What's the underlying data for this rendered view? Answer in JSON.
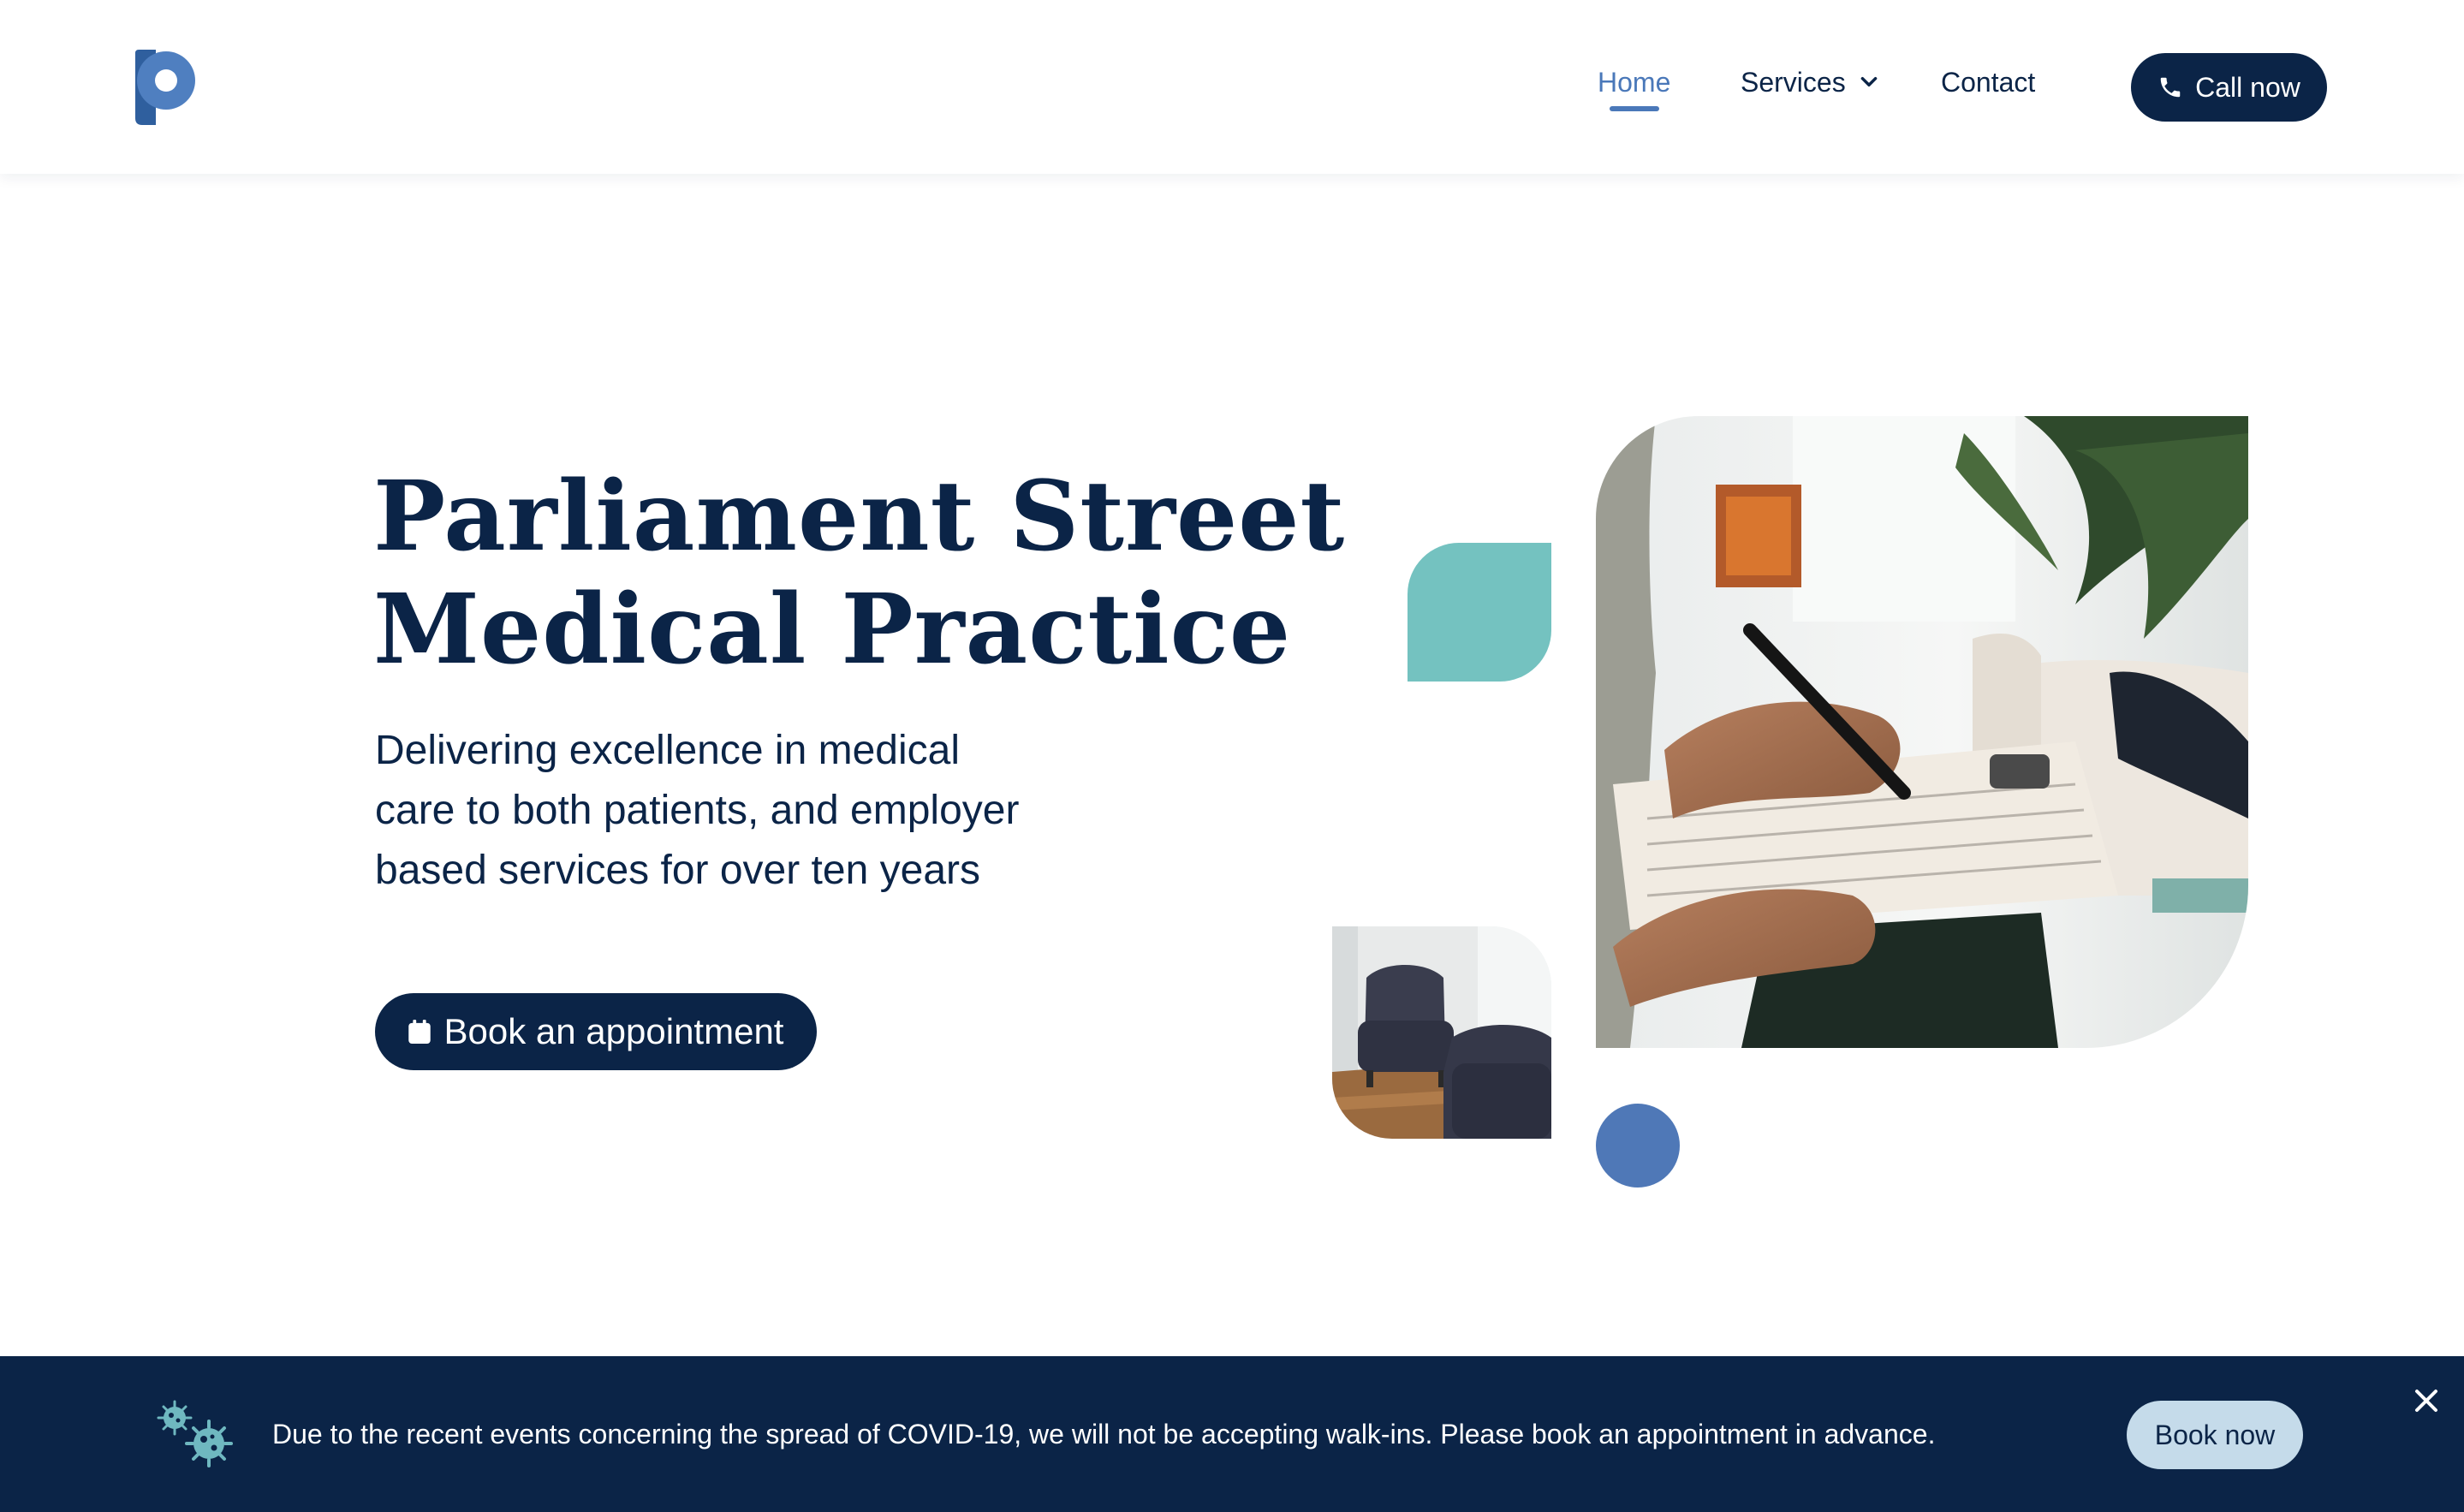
{
  "header": {
    "logo_icon": "p-logo-icon",
    "nav": {
      "home_label": "Home",
      "services_label": "Services",
      "services_icon": "chevron-down-icon",
      "contact_label": "Contact"
    },
    "call_button": {
      "label": "Call now",
      "icon": "phone-icon"
    }
  },
  "hero": {
    "title_line1": "Parliament Street",
    "title_line2": "Medical Practice",
    "subtitle_line1": "Delivering excellence in medical",
    "subtitle_line2": "care to both patients, and employer",
    "subtitle_line3": "based services for over ten years",
    "book_button": {
      "label": "Book an appointment",
      "icon": "calendar-icon"
    }
  },
  "banner": {
    "icon": "virus-icon",
    "message": "Due to the recent events concerning the spread of COVID-19, we will not be accepting walk-ins. Please book an appointment in advance.",
    "book_label": "Book now",
    "close_icon": "close-icon"
  },
  "colors": {
    "navy": "#0b2447",
    "accent_blue": "#4a78b9",
    "teal": "#74c2c0",
    "light_blue": "#c5dbea",
    "white": "#ffffff"
  }
}
